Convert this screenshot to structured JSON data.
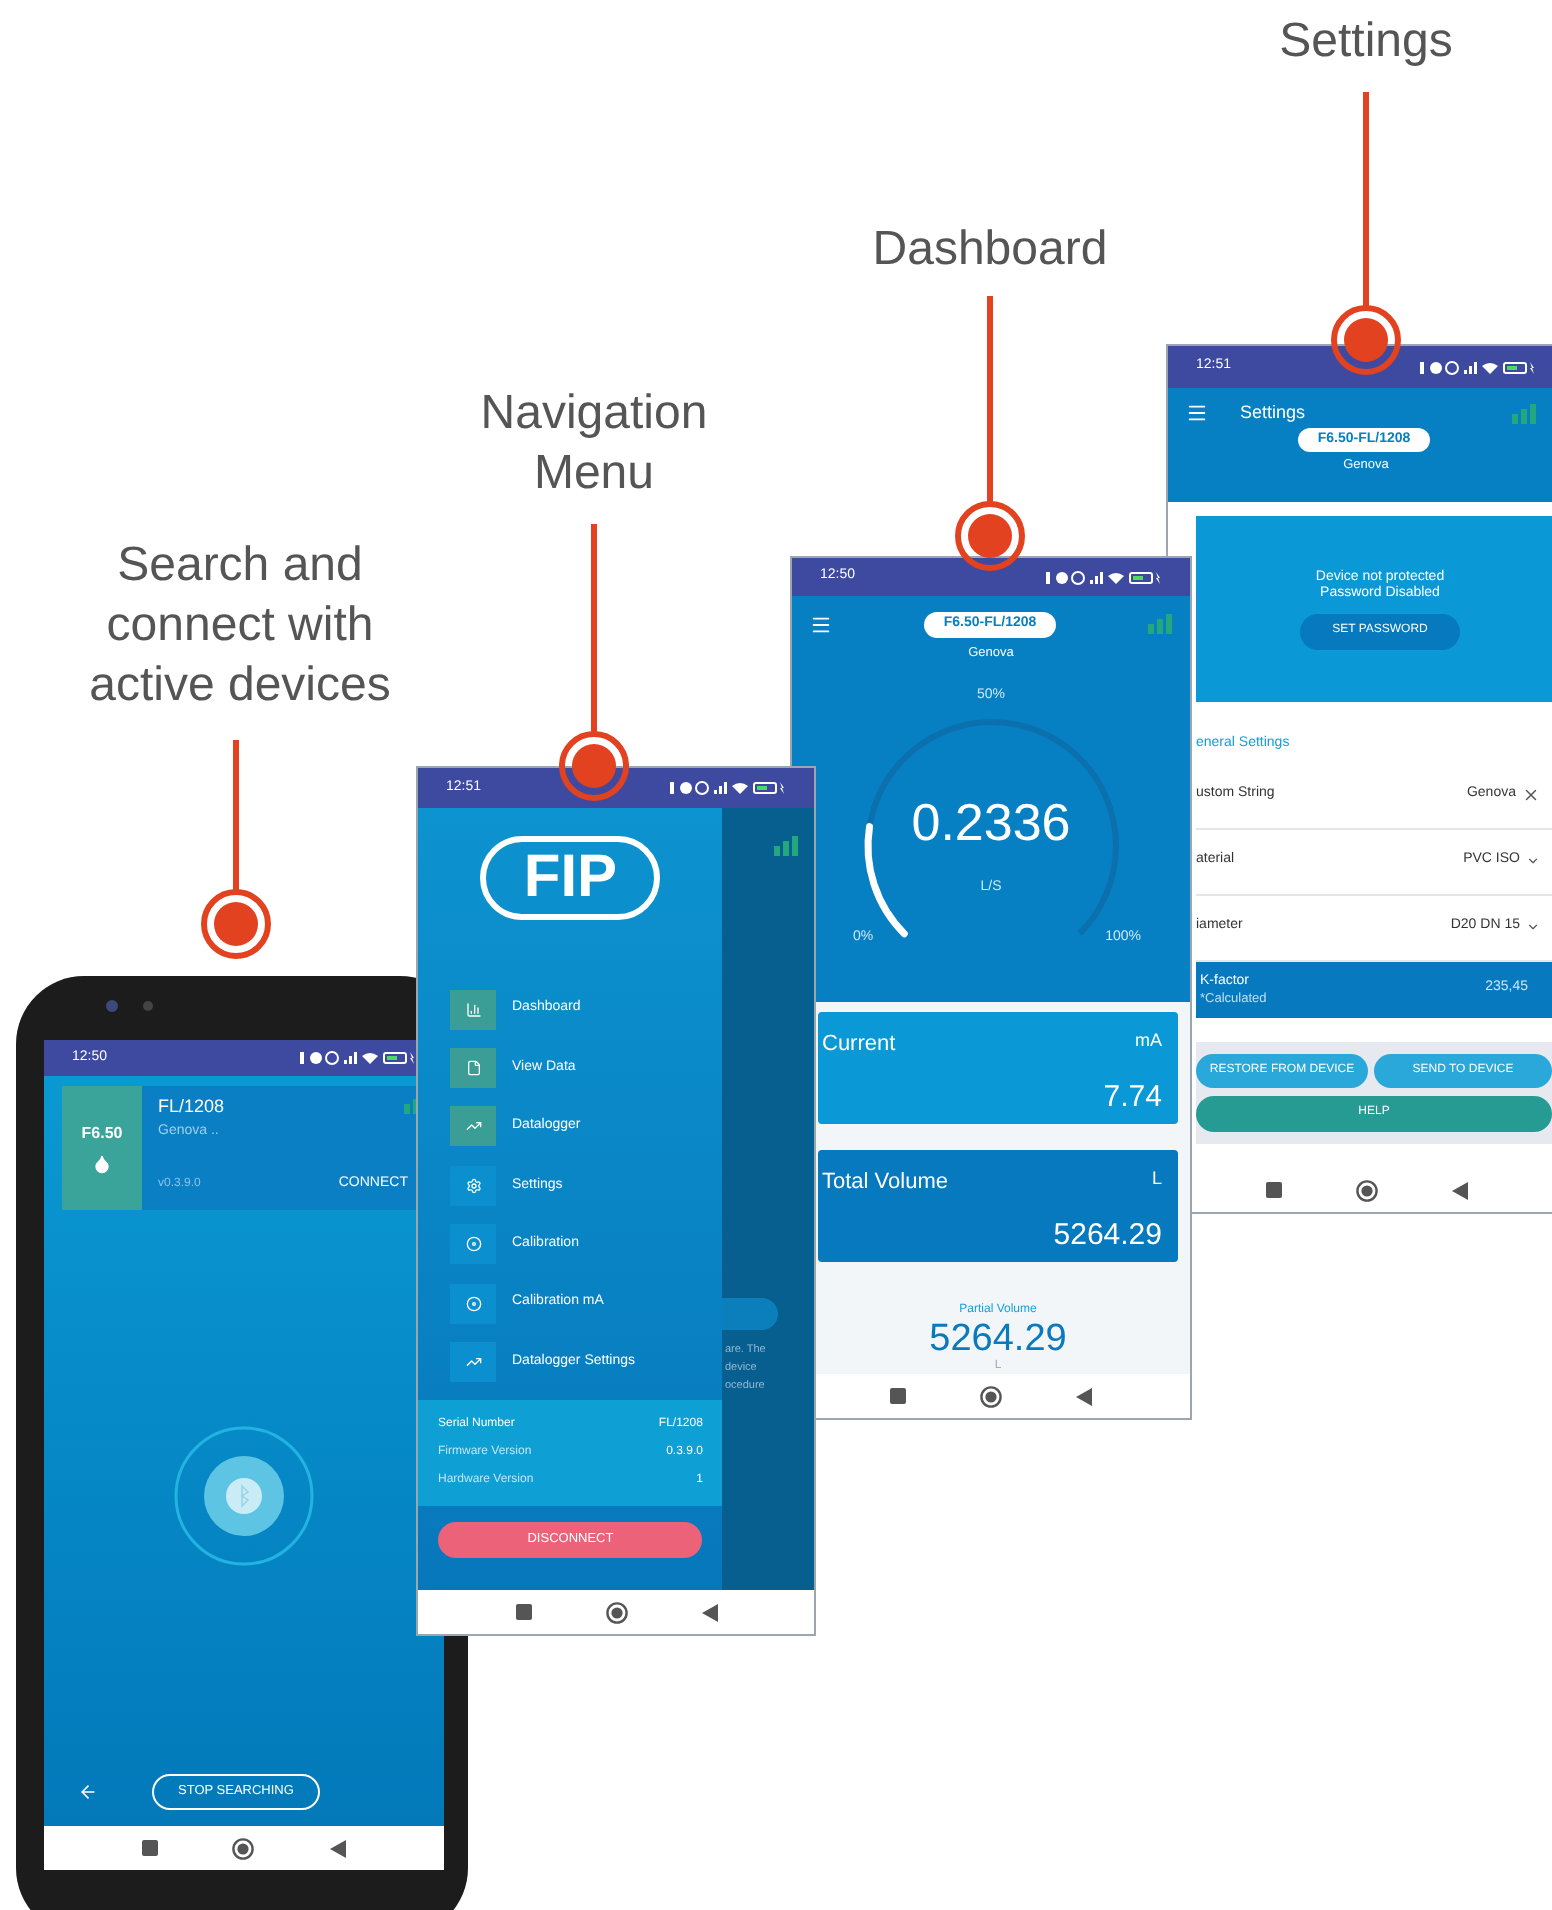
{
  "screens": [
    {
      "kind": "search",
      "callout": "Search and connect with active devices",
      "status_time": "12:50",
      "device": {
        "model": "F6.50",
        "name": "FL/1208",
        "location": "Genova ..",
        "version": "v0.3.9.0",
        "action": "CONNECT"
      },
      "stop_button": "STOP SEARCHING"
    },
    {
      "kind": "navigation",
      "callout": "Navigation Menu",
      "status_time": "12:51",
      "logo": "FIP",
      "menu": [
        {
          "label": "Dashboard",
          "kind": "chart",
          "color": "#3a9e97"
        },
        {
          "label": "View Data",
          "kind": "file",
          "color": "#3a9e97"
        },
        {
          "label": "Datalogger",
          "kind": "trend",
          "color": "#3a9e97"
        },
        {
          "label": "Settings",
          "kind": "gear",
          "color": "#0c8fcf"
        },
        {
          "label": "Calibration",
          "kind": "disc",
          "color": "#0c8fcf"
        },
        {
          "label": "Calibration mA",
          "kind": "disc",
          "color": "#0c8fcf"
        },
        {
          "label": "Datalogger Settings",
          "kind": "trend",
          "color": "#0c8fcf"
        }
      ],
      "info": [
        {
          "label": "Serial Number",
          "value": "FL/1208"
        },
        {
          "label": "Firmware Version",
          "value": "0.3.9.0"
        },
        {
          "label": "Hardware Version",
          "value": "1"
        }
      ],
      "disconnect": "DISCONNECT",
      "behind_text": [
        "are. The",
        "device",
        "ocedure"
      ]
    },
    {
      "kind": "dashboard",
      "callout": "Dashboard",
      "status_time": "12:50",
      "device_tag": "F6.50-FL/1208",
      "location": "Genova",
      "gauge": {
        "top_label": "50%",
        "value": "0.2336",
        "unit": "L/S",
        "min_label": "0%",
        "max_label": "100%",
        "level": 0.2
      },
      "cards": [
        {
          "label": "Current",
          "unit": "mA",
          "value": "7.74"
        },
        {
          "label": "Total Volume",
          "unit": "L",
          "value": "5264.29"
        }
      ],
      "partial": {
        "label": "Partial Volume",
        "value": "5264.29",
        "unit": "L"
      }
    },
    {
      "kind": "settings",
      "callout": "Settings",
      "status_time": "12:51",
      "title": "Settings",
      "device_tag": "F6.50-FL/1208",
      "location": "Genova",
      "password": {
        "lines": [
          "Device not protected",
          "Password Disabled"
        ],
        "button": "SET PASSWORD"
      },
      "section": "eneral Settings",
      "rows": [
        {
          "kind": "text",
          "label": "ustom String",
          "value": "Genova"
        },
        {
          "kind": "select",
          "label": "aterial",
          "value": "PVC ISO"
        },
        {
          "kind": "select",
          "label": "iameter",
          "value": "D20 DN 15"
        },
        {
          "kind": "info",
          "label": "K-factor",
          "note": "*Calculated",
          "value": "235,45"
        }
      ],
      "buttons": [
        "RESTORE FROM DEVICE",
        "SEND TO DEVICE",
        "HELP"
      ]
    }
  ]
}
